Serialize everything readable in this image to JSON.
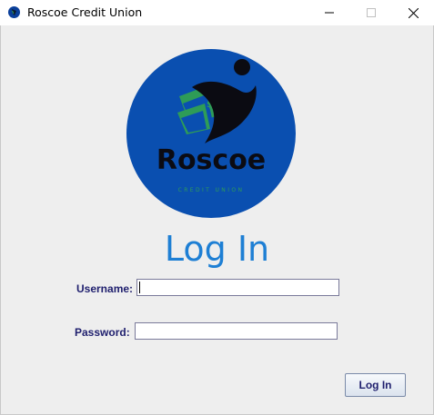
{
  "window": {
    "title": "Roscoe Credit Union"
  },
  "logo": {
    "brand": "Roscoe",
    "tagline": "CREDIT UNION",
    "circle_color": "#0a4fb0",
    "accent_color": "#2e9c57"
  },
  "form": {
    "heading": "Log In",
    "username_label": "Username:",
    "username_value": "",
    "password_label": "Password:",
    "password_value": "",
    "submit_label": "Log In"
  },
  "icons": {
    "app": "app-logo-icon",
    "minimize": "minimize-icon",
    "maximize": "maximize-icon",
    "close": "close-icon"
  }
}
